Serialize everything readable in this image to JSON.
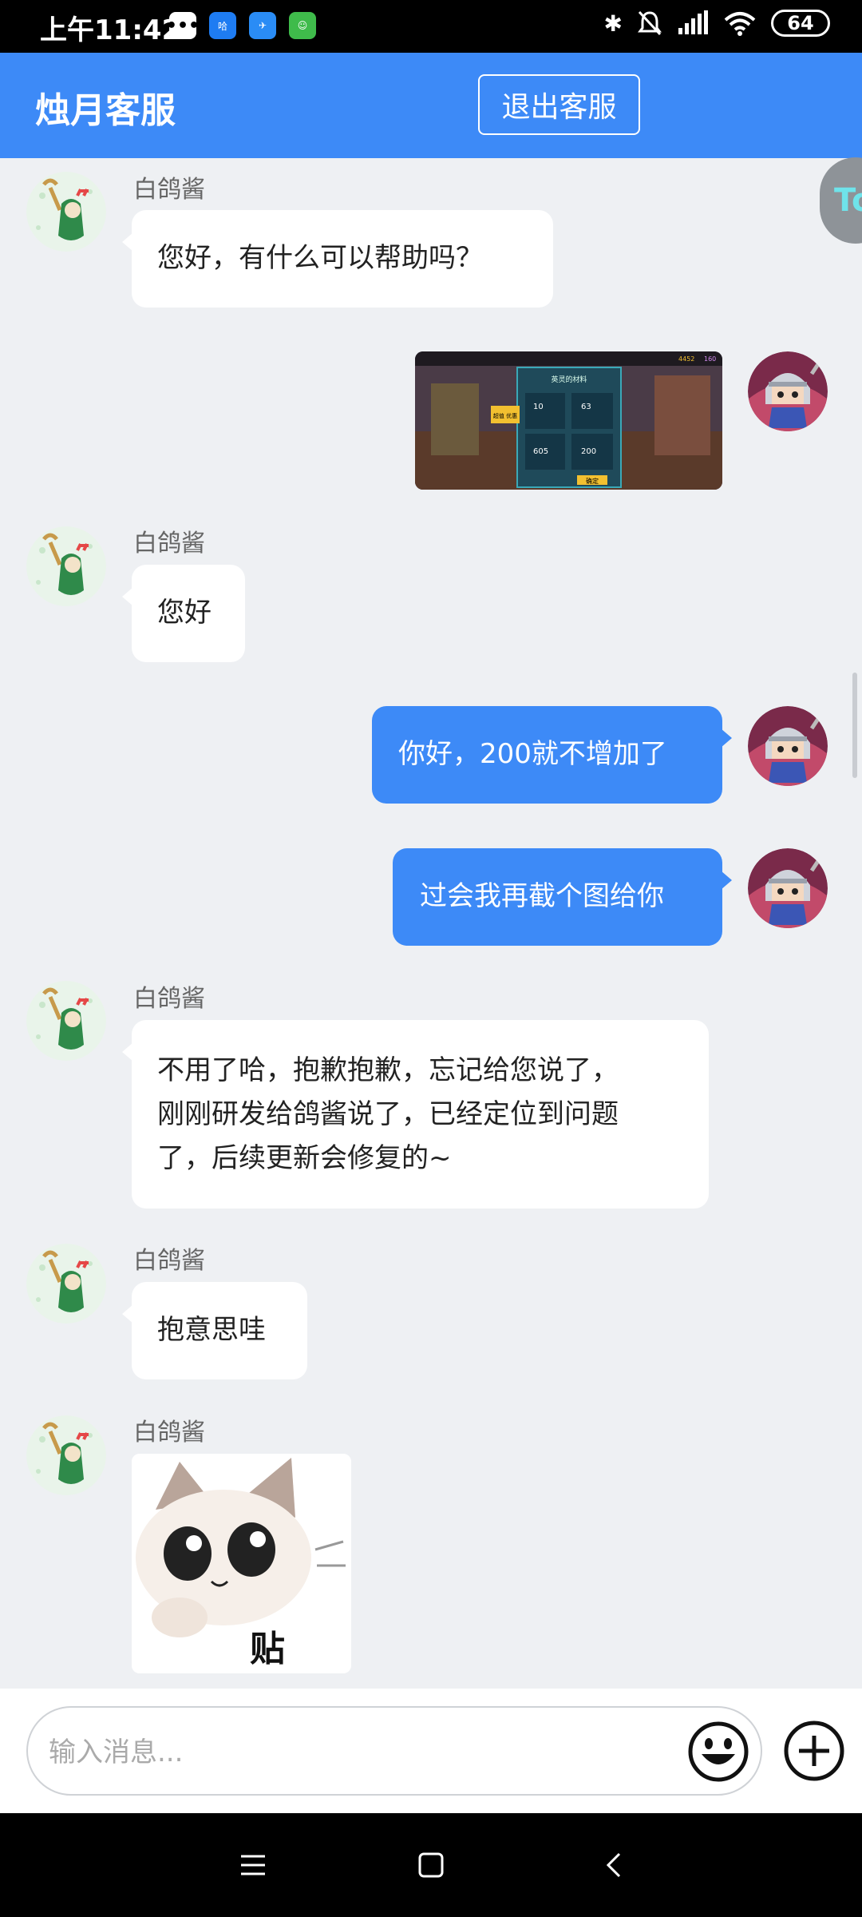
{
  "status": {
    "time": "上午11:42",
    "battery": "64"
  },
  "header": {
    "title": "烛月客服",
    "exit_label": "退出客服"
  },
  "float_badge": "To",
  "messages": [
    {
      "sender": "白鸽酱",
      "text": "您好，有什么可以帮助吗？"
    },
    {
      "sender": "白鸽酱",
      "text": "您好"
    },
    {
      "text": "你好，200就不增加了"
    },
    {
      "text": "过会我再截个图给你"
    },
    {
      "sender": "白鸽酱",
      "lines": [
        "不用了哈，抱歉抱歉，忘记给您说了，",
        "刚刚研发给鸽酱说了，已经定位到问题",
        "了，后续更新会修复的~"
      ]
    },
    {
      "sender": "白鸽酱",
      "text": "抱意思哇"
    },
    {
      "sender": "白鸽酱"
    }
  ],
  "screenshot_image": {
    "coins": "4452",
    "gems": "160",
    "panel_title": "英灵的材料",
    "values": [
      "10",
      "63",
      "605",
      "200"
    ],
    "confirm": "确定",
    "side_label": "超值 优惠"
  },
  "sticker_text": "贴贴！",
  "composer": {
    "placeholder": "输入消息..."
  }
}
